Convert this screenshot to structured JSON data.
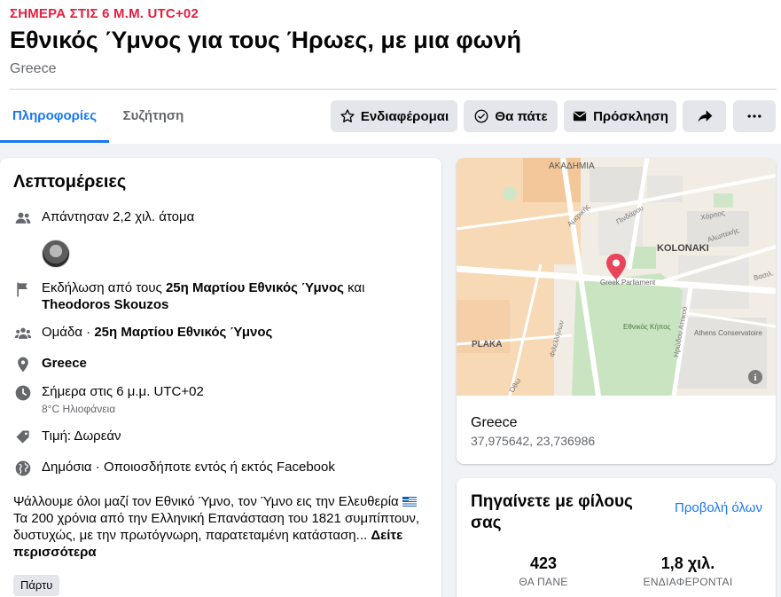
{
  "event": {
    "date_line": "ΣΗΜΕΡΑ ΣΤΙΣ 6 Μ.Μ. UTC+02",
    "title": "Εθνικός Ύμνος για τους Ήρωες, με μια φωνή",
    "location": "Greece"
  },
  "tabs": [
    {
      "label": "Πληροφορίες",
      "active": true
    },
    {
      "label": "Συζήτηση",
      "active": false
    }
  ],
  "actions": {
    "interested": "Ενδιαφέρομαι",
    "going": "Θα πάτε",
    "invite": "Πρόσκληση"
  },
  "details": {
    "heading": "Λεπτομέρειες",
    "responded": "Απάντησαν 2,2 χιλ. άτομα",
    "hosted_prefix": "Εκδήλωση από τους ",
    "host_1": "25η Μαρτίου Εθνικός Ύμνος",
    "hosted_and": " και",
    "host_2": "Theodoros Skouzos",
    "group_prefix": "Ομάδα · ",
    "group_name": "25η Μαρτίου Εθνικός Ύμνος",
    "place": "Greece",
    "time": "Σήμερα στις 6 μ.μ. UTC+02",
    "weather": "8°C Ηλιοφάνεια",
    "price": "Τιμή: Δωρεάν",
    "privacy": "Δημόσια · Οποιοσδήποτε εντός ή εκτός Facebook",
    "description_line_1": "Ψάλλουμε όλοι μαζί τον Εθνικό Ύμνο, τον Ύμνο εις την Ελευθερία",
    "description_line_2": "Τα 200 χρόνια από την Ελληνική Επανάσταση του 1821 συμπίπτουν,",
    "description_line_3": "δυστυχώς, με την πρωτόγνωρη, παρατεταμένη κατάσταση...",
    "see_more": "Δείτε περισσότερα",
    "category_tag": "Πάρτυ"
  },
  "map": {
    "labels": {
      "akadimia": "ΑΚΑΔΗΜΙΑ",
      "kolonaki": "KOLONAKI",
      "plaka": "PLAKA",
      "parliament": "Greek Parliament",
      "garden": "Εθνικός Κήπος",
      "conservatoire": "Athens Conservatoire",
      "street_1": "Αμερικής",
      "street_2": "Πινδάρου",
      "street_3": "Χάριτος",
      "street_4": "Αλωπεκής",
      "street_5": "Βασιλ.",
      "street_6": "Φιλελλήνων",
      "street_7": "Ηρώδου Αττικού",
      "street_8": "Όθω"
    },
    "place_name": "Greece",
    "coordinates": "37,975642, 23,736986",
    "info_glyph": "i"
  },
  "friends": {
    "heading": "Πηγαίνετε με φίλους σας",
    "see_all": "Προβολή όλων",
    "going_count": "423",
    "going_label": "ΘΑ ΠΑΝΕ",
    "interested_count": "1,8 χιλ.",
    "interested_label": "ΕΝΔΙΑΦΕΡΟΝΤΑΙ"
  },
  "colors": {
    "accent": "#1877f2",
    "date_red": "#e41e3f",
    "map_pin": "#e8445a"
  }
}
